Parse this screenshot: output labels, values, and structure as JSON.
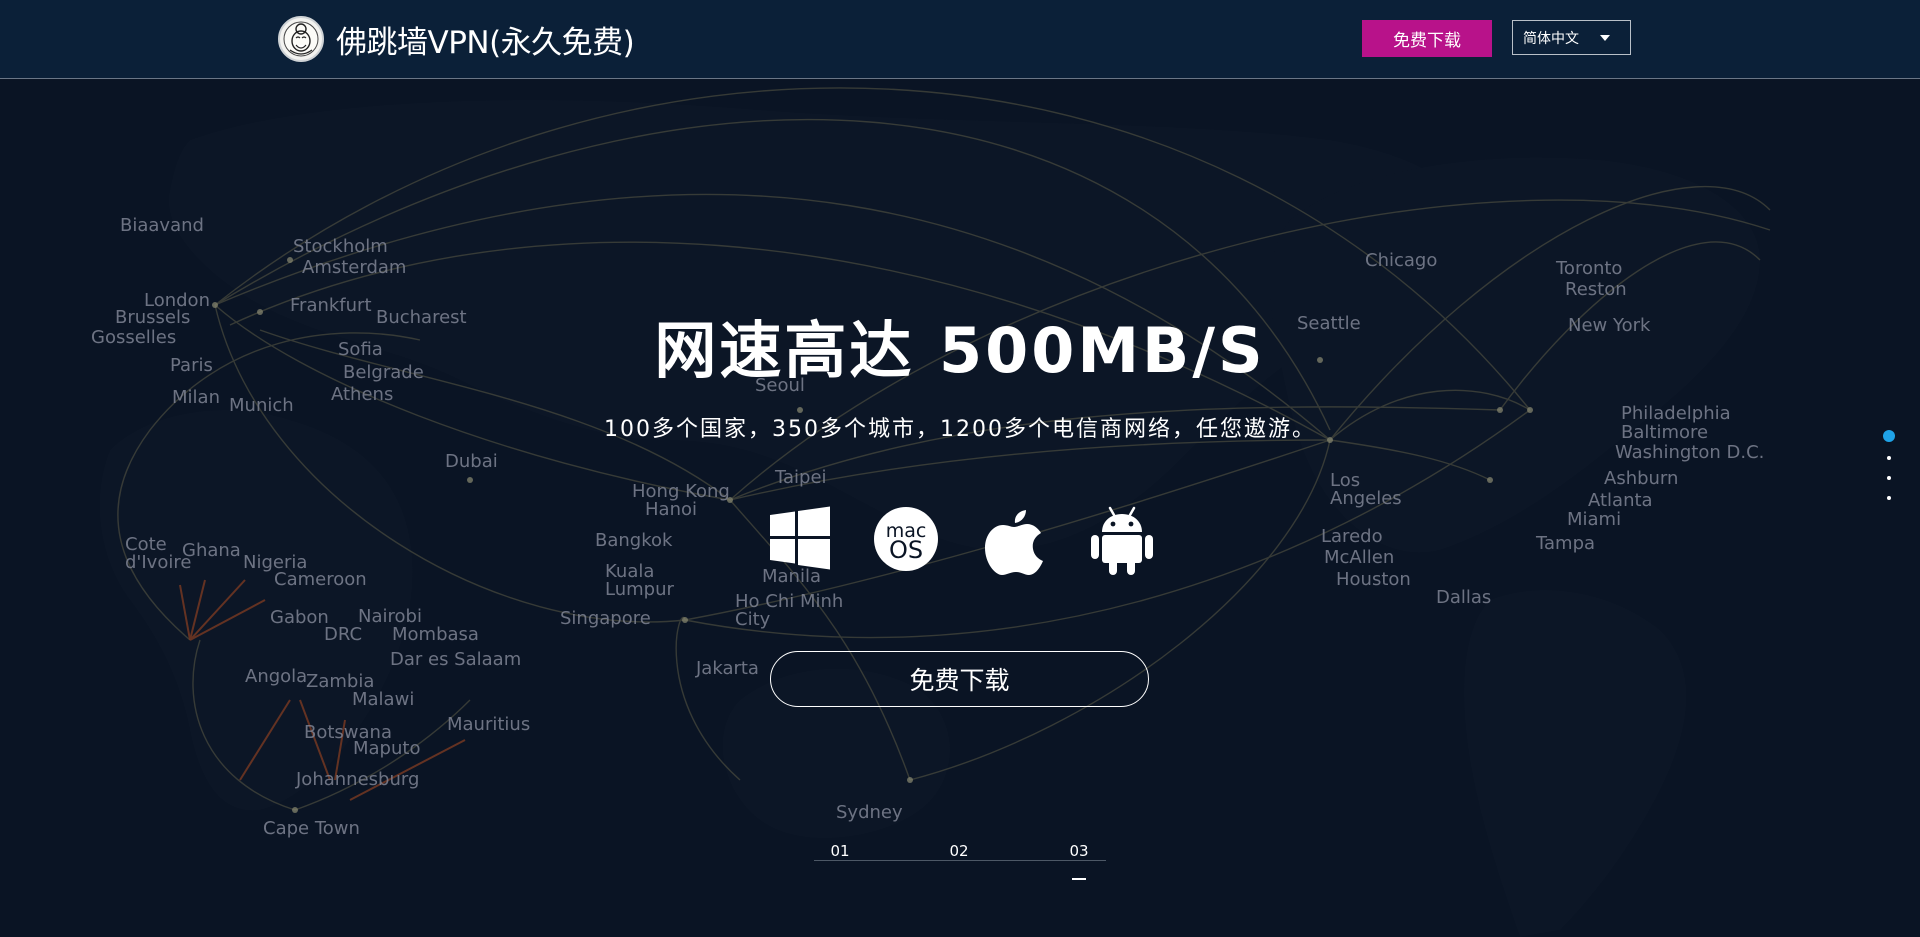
{
  "header": {
    "brand_name": "佛跳墙VPN(永久免费)",
    "download_label": "免费下载",
    "language_selected": "简体中文",
    "accent_color": "#b8128a"
  },
  "hero": {
    "title": "网速高达 500MB/S",
    "subtitle": "100多个国家，350多个城市，1200多个电信商网络，任您遨游。",
    "download_label": "免费下载",
    "platforms": [
      "windows-icon",
      "macos-icon",
      "apple-icon",
      "android-icon"
    ],
    "macos_icon_text": {
      "top": "mac",
      "bottom": "OS"
    }
  },
  "map": {
    "cities": [
      "Biaavand",
      "Stockholm",
      "Amsterdam",
      "London",
      "Brussels",
      "Gosselles",
      "Frankfurt",
      "Bucharest",
      "Sofia",
      "Belgrade",
      "Athens",
      "Paris",
      "Milan",
      "Munich",
      "Dubai",
      "Cote d'Ivoire",
      "Ghana",
      "Nigeria",
      "Cameroon",
      "Gabon",
      "Nairobi",
      "DRC",
      "Mombasa",
      "Dar es Salaam",
      "Angola",
      "Zambia",
      "Malawi",
      "Botswana",
      "Maputo",
      "Mauritius",
      "Johannesburg",
      "Cape Town",
      "Seoul",
      "Taipei",
      "Hong Kong",
      "Hanoi",
      "Bangkok",
      "Kuala Lumpur",
      "Manila",
      "Ho Chi Minh City",
      "Singapore",
      "Jakarta",
      "Sydney",
      "Chicago",
      "Toronto",
      "Reston",
      "New York",
      "Seattle",
      "Philadelphia",
      "Baltimore",
      "Washington D.C.",
      "Ashburn",
      "Atlanta",
      "Miami",
      "Tampa",
      "Los Angeles",
      "Laredo",
      "McAllen",
      "Houston",
      "Dallas"
    ]
  },
  "slides": {
    "tabs": [
      "01",
      "02",
      "03"
    ],
    "active_index": 2
  },
  "pagination": {
    "count": 4,
    "active_index": 0,
    "active_color": "#1fa3e8"
  }
}
